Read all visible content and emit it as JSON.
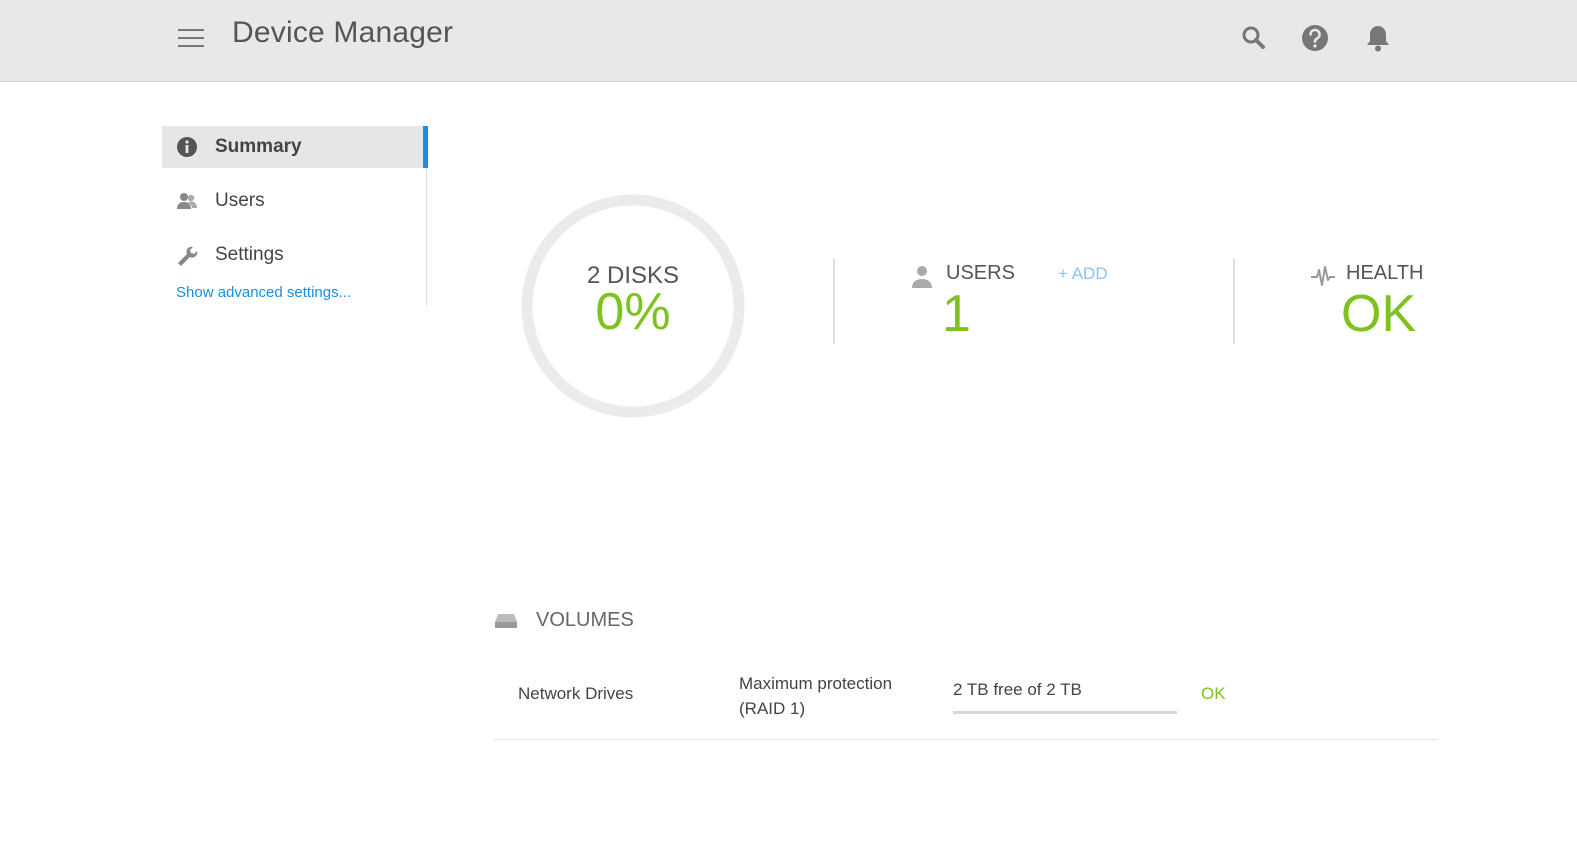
{
  "header": {
    "title": "Device Manager",
    "icons": [
      "menu-icon",
      "search-icon",
      "help-icon",
      "bell-icon"
    ]
  },
  "sidebar": {
    "items": [
      {
        "label": "Summary",
        "icon": "info-icon",
        "active": true
      },
      {
        "label": "Users",
        "icon": "users-icon",
        "active": false
      },
      {
        "label": "Settings",
        "icon": "wrench-icon",
        "active": false
      }
    ],
    "advanced_link": "Show advanced settings..."
  },
  "stats": {
    "disks": {
      "label": "2 DISKS",
      "value": "0%",
      "used_fraction": 0
    },
    "users": {
      "label": "USERS",
      "add_label": "+ ADD",
      "count": "1"
    },
    "health": {
      "label": "HEALTH",
      "value": "OK"
    }
  },
  "volumes": {
    "title": "VOLUMES",
    "rows": [
      {
        "name": "Network Drives",
        "protection": "Maximum protection (RAID 1)",
        "free": "2 TB free of 2 TB",
        "used_fraction": 0,
        "status": "OK"
      }
    ]
  },
  "colors": {
    "accent_green": "#7dc21e",
    "accent_blue": "#1a8fe3",
    "add_link": "#8cc4ee"
  }
}
